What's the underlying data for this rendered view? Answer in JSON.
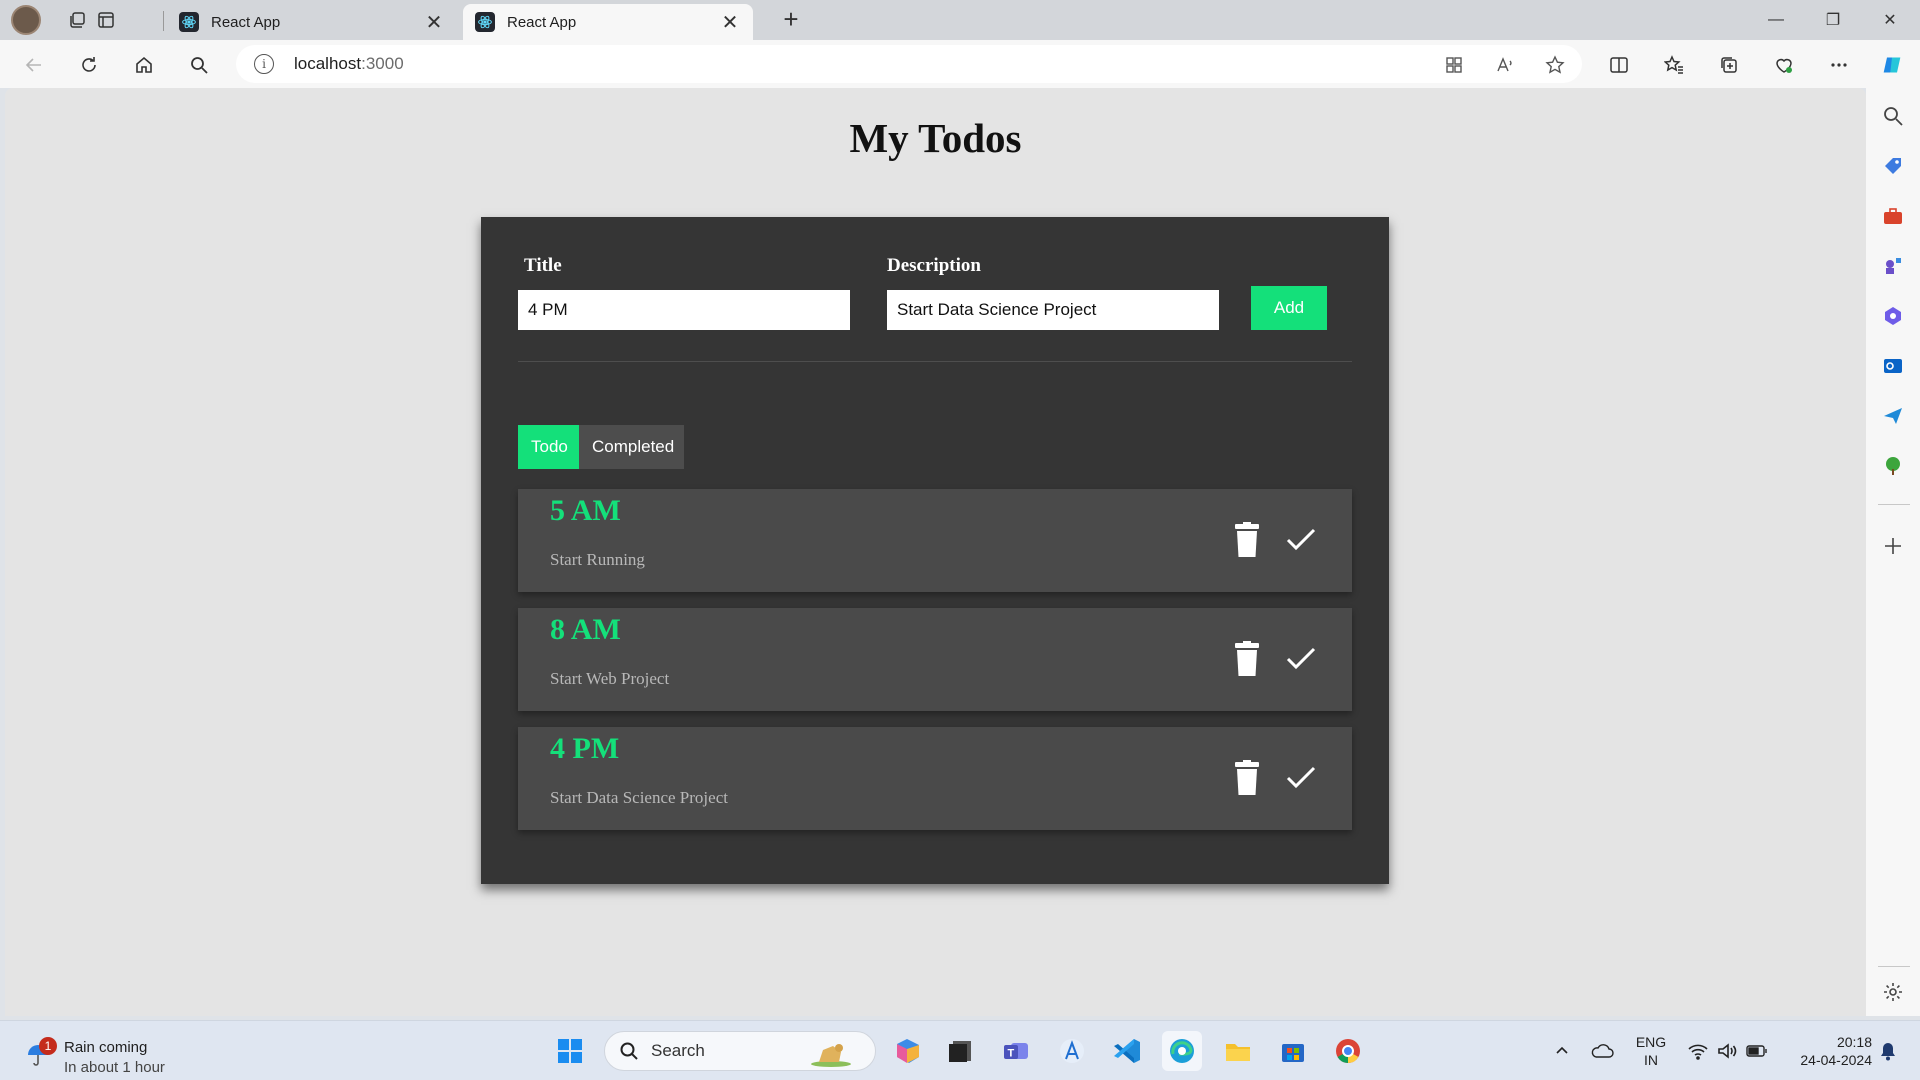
{
  "browser": {
    "tabs": [
      {
        "label": "React App",
        "active": false
      },
      {
        "label": "React App",
        "active": true
      }
    ],
    "url_host": "localhost",
    "url_port": ":3000",
    "accent_color": "#1e88e5"
  },
  "app": {
    "title": "My Todos",
    "form": {
      "title_label": "Title",
      "title_value": "4 PM",
      "description_label": "Description",
      "description_value": "Start Data Science Project",
      "add_label": "Add"
    },
    "tabs": {
      "todo_label": "Todo",
      "completed_label": "Completed",
      "active": "todo"
    },
    "todos": [
      {
        "title": "5 AM",
        "description": "Start Running"
      },
      {
        "title": "8 AM",
        "description": "Start Web Project"
      },
      {
        "title": "4 PM",
        "description": "Start Data Science Project"
      }
    ],
    "colors": {
      "accent": "#14e07a",
      "card": "#353535",
      "item": "#4a4a4a"
    }
  },
  "taskbar": {
    "weather": {
      "line1": "Rain coming",
      "line2": "In about 1 hour",
      "badge": "1"
    },
    "search_placeholder": "Search",
    "language": {
      "line1": "ENG",
      "line2": "IN"
    },
    "time": "20:18",
    "date": "24-04-2024"
  }
}
